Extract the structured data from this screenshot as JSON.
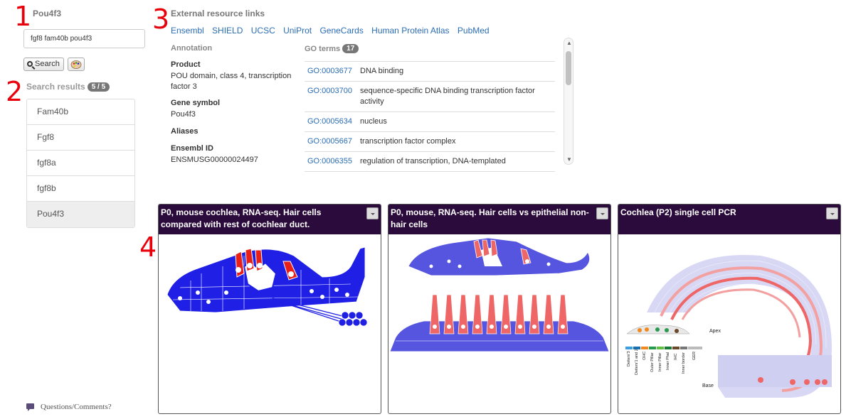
{
  "markers": {
    "m1": "1",
    "m2": "2",
    "m3": "3",
    "m4": "4"
  },
  "sidebar": {
    "gene_title": "Pou4f3",
    "search_value": "fgf8 fam40b pou4f3",
    "search_button": "Search",
    "results_label": "Search results",
    "results_count": "5 / 5",
    "results": [
      "Fam40b",
      "Fgf8",
      "fgf8a",
      "fgf8b",
      "Pou4f3"
    ],
    "comments_link": "Questions/Comments?"
  },
  "external": {
    "heading": "External resource links",
    "links": [
      "Ensembl",
      "SHIELD",
      "UCSC",
      "UniProt",
      "GeneCards",
      "Human Protein Atlas",
      "PubMed"
    ]
  },
  "annotation": {
    "title": "Annotation",
    "product_label": "Product",
    "product_value": "POU domain, class 4, transcription factor 3",
    "symbol_label": "Gene symbol",
    "symbol_value": "Pou4f3",
    "aliases_label": "Aliases",
    "ensembl_label": "Ensembl ID",
    "ensembl_value": "ENSMUSG00000024497"
  },
  "go": {
    "title": "GO terms",
    "count": "17",
    "rows": [
      {
        "id": "GO:0003677",
        "desc": "DNA binding"
      },
      {
        "id": "GO:0003700",
        "desc": "sequence-specific DNA binding transcription factor activity"
      },
      {
        "id": "GO:0005634",
        "desc": "nucleus"
      },
      {
        "id": "GO:0005667",
        "desc": "transcription factor complex"
      },
      {
        "id": "GO:0006355",
        "desc": "regulation of transcription, DNA-templated"
      }
    ]
  },
  "panels": [
    {
      "title": "P0, mouse cochlea, RNA-seq. Hair cells compared with rest of cochlear duct."
    },
    {
      "title": "P0, mouse, RNA-seq. Hair cells vs epithelial non-hair cells"
    },
    {
      "title": "Cochlea (P2) single cell PCR",
      "apex_label": "Apex",
      "base_label": "Base",
      "legend": [
        "Deiters'3",
        "Deiters'1 and 2",
        "OHC",
        "Outer Pillar",
        "Inner Pillar",
        "Inner Phal",
        "IHC",
        "Inner border",
        "GER"
      ]
    }
  ],
  "colors": {
    "panel_header": "#2b0b3b",
    "link": "#2a6db5",
    "cell_blue": "#1f1fe6",
    "cell_light": "#5555e0",
    "hair_red": "#e8201a"
  }
}
